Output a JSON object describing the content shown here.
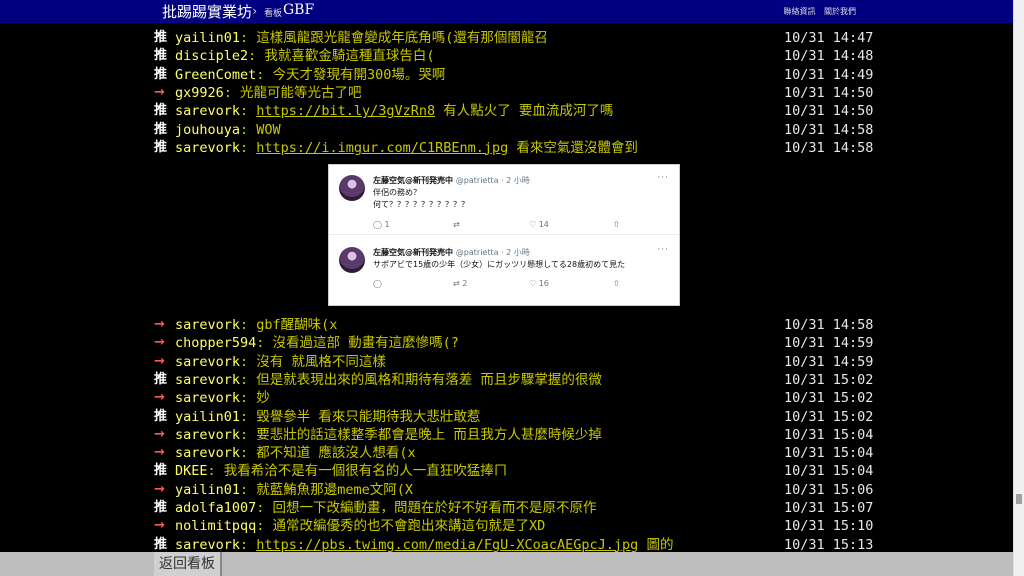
{
  "header": {
    "board_link": "批踢踢實業坊",
    "separator": "›",
    "crumb_label": "看板",
    "board_name": "GBF",
    "nav": [
      "聯絡資訊",
      "關於我們"
    ]
  },
  "pushes_top": [
    {
      "tag": "推",
      "type": "push",
      "user": "yailin01",
      "msg": ": 這樣風龍跟光龍會變成年底角嗎(還有那個闇龍召",
      "ip": "10/31 14:47"
    },
    {
      "tag": "推",
      "type": "push",
      "user": "disciple2",
      "msg": ": 我就喜歡金騎這種直球告白(",
      "ip": "10/31 14:48"
    },
    {
      "tag": "推",
      "type": "push",
      "user": "GreenComet",
      "msg": ": 今天才發現有開300場。哭啊",
      "ip": "10/31 14:49"
    },
    {
      "tag": "→",
      "type": "arrow",
      "user": "gx9926",
      "msg": ": 光龍可能等光古了吧",
      "ip": "10/31 14:50"
    },
    {
      "tag": "推",
      "type": "push",
      "user": "sarevork",
      "msg_pre": ": ",
      "link": "https://bit.ly/3gVzRn8",
      "msg_post": " 有人點火了 要血流成河了嗎",
      "ip": "10/31 14:50"
    },
    {
      "tag": "推",
      "type": "push",
      "user": "jouhouya",
      "msg": ": WOW",
      "ip": "10/31 14:58"
    },
    {
      "tag": "推",
      "type": "push",
      "user": "sarevork",
      "msg_pre": ": ",
      "link": "https://i.imgur.com/C1RBEnm.jpg",
      "msg_post": " 看來空氣還沒體會到",
      "ip": "10/31 14:58"
    }
  ],
  "tweets": [
    {
      "name": "左藤空気@新刊発売中",
      "handle": "@patrietta · 2 小時",
      "more": "···",
      "text": [
        "伴侶の務め？",
        "何て？？？？？？？？？？"
      ],
      "reply": "1",
      "retweet": "",
      "like": "14"
    },
    {
      "name": "左藤空気@新刊発売中",
      "handle": "@patrietta · 2 小時",
      "more": "···",
      "text": [
        "サポアビで15歳の少年（少女）にガッツリ懸想してる28歳初めて見た"
      ],
      "reply": "",
      "retweet": "2",
      "like": "16"
    }
  ],
  "pushes_bottom": [
    {
      "tag": "→",
      "type": "arrow",
      "user": "sarevork",
      "msg": ": gbf醒醐味(x",
      "ip": "10/31 14:58"
    },
    {
      "tag": "→",
      "type": "arrow",
      "user": "chopper594",
      "msg": ": 沒看過這部  動畫有這麼慘嗎(?",
      "ip": "10/31 14:59"
    },
    {
      "tag": "→",
      "type": "arrow",
      "user": "sarevork",
      "msg": ": 沒有 就風格不同這樣",
      "ip": "10/31 14:59"
    },
    {
      "tag": "推",
      "type": "push",
      "user": "sarevork",
      "msg": ": 但是就表現出來的風格和期待有落差 而且步驟掌握的很微",
      "ip": "10/31 15:02"
    },
    {
      "tag": "→",
      "type": "arrow",
      "user": "sarevork",
      "msg": ": 妙",
      "ip": "10/31 15:02"
    },
    {
      "tag": "推",
      "type": "push",
      "user": "yailin01",
      "msg": ": 毀譽參半 看來只能期待我大悲壯敢惹",
      "ip": "10/31 15:02"
    },
    {
      "tag": "→",
      "type": "arrow",
      "user": "sarevork",
      "msg": ": 要悲壯的話這樣整季都會是晚上 而且我方人甚麼時候少掉",
      "ip": "10/31 15:04"
    },
    {
      "tag": "→",
      "type": "arrow",
      "user": "sarevork",
      "msg": ": 都不知道 應該沒人想看(x",
      "ip": "10/31 15:04"
    },
    {
      "tag": "推",
      "type": "push",
      "user": "DKEE",
      "msg": ": 我看希洽不是有一個很有名的人一直狂吹猛捧ㄇ",
      "ip": "10/31 15:04"
    },
    {
      "tag": "→",
      "type": "arrow",
      "user": "yailin01",
      "msg": ": 就藍鮪魚那邊meme文阿(X",
      "ip": "10/31 15:06"
    },
    {
      "tag": "推",
      "type": "push",
      "user": "adolfa1007",
      "msg": ": 回想一下改編動畫，問題在於好不好看而不是原不原作",
      "ip": "10/31 15:07"
    },
    {
      "tag": "→",
      "type": "arrow",
      "user": "nolimitpqq",
      "msg": ": 通常改編優秀的也不會跑出來講這句就是了XD",
      "ip": "10/31 15:10"
    },
    {
      "tag": "推",
      "type": "push",
      "user": "sarevork",
      "msg_pre": ": ",
      "link": "https://pbs.twimg.com/media/FgU-XCoacAEGpcJ.jpg",
      "msg_post": " 圖的",
      "ip": "10/31 15:13"
    }
  ],
  "footer": {
    "back_label": "返回看板"
  }
}
